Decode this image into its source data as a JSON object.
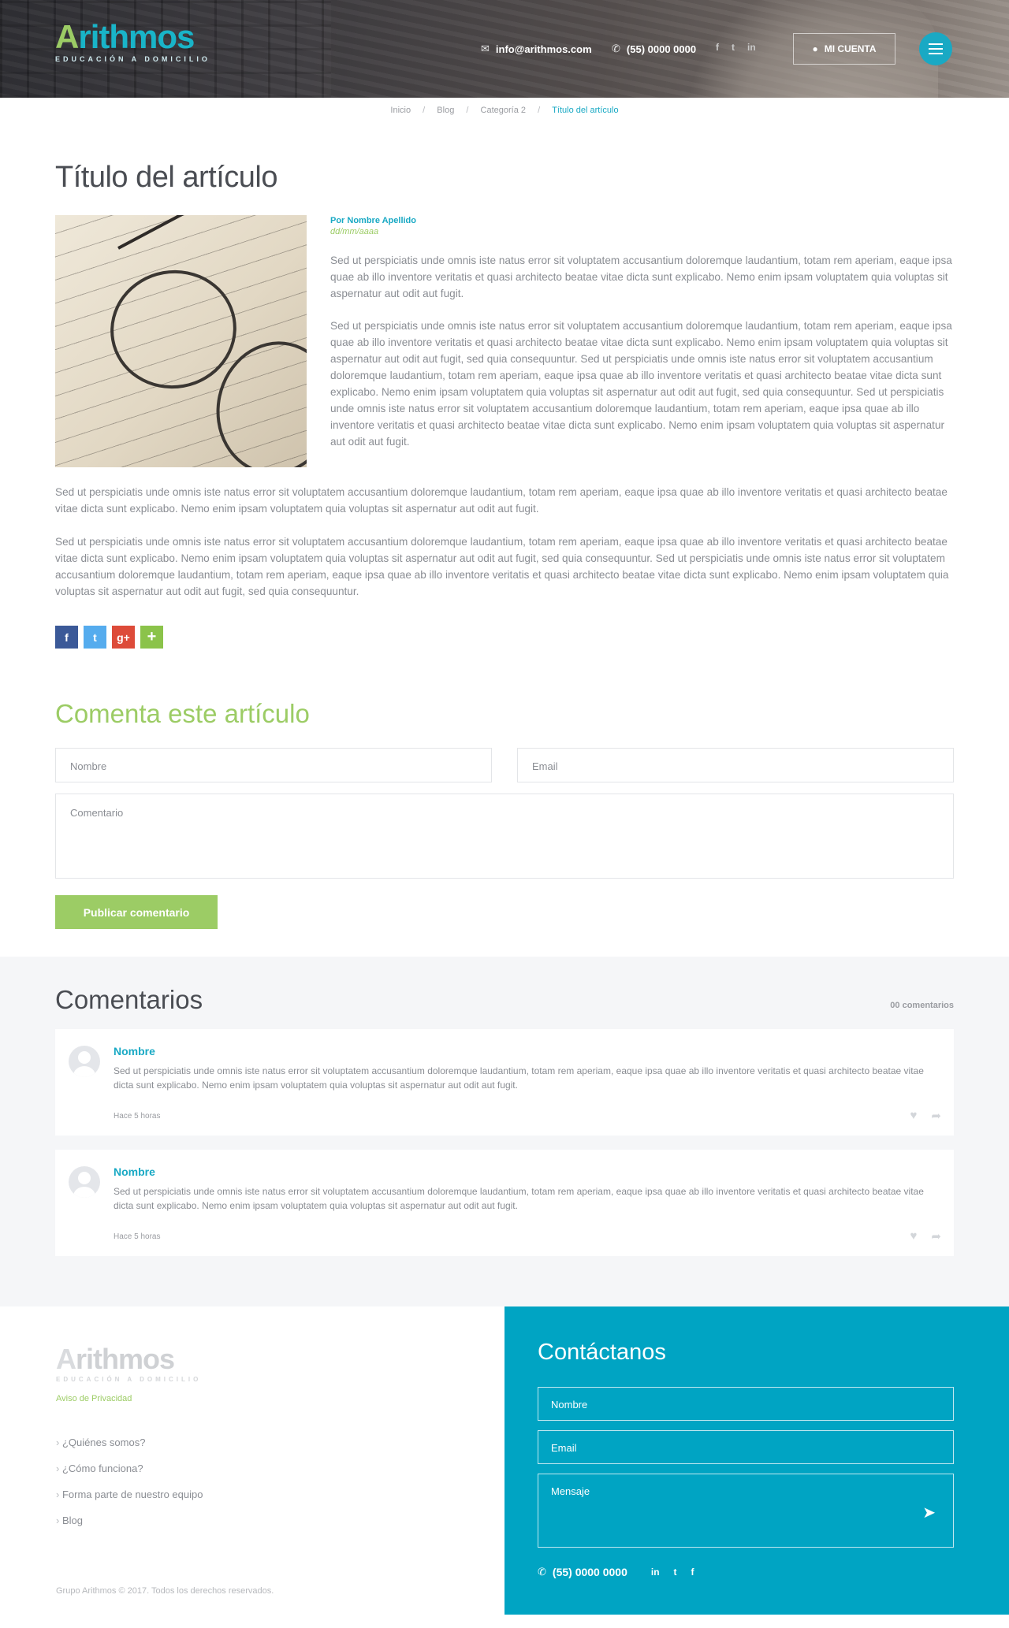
{
  "header": {
    "logo_text": "Arithmos",
    "logo_first_letter": "A",
    "logo_rest": "rithmos",
    "logo_tagline": "EDUCACIÓN A DOMICILIO",
    "email": "info@arithmos.com",
    "phone": "(55) 0000 0000",
    "account_label": "MI CUENTA",
    "social": [
      "facebook-icon",
      "twitter-icon",
      "linkedin-icon"
    ]
  },
  "breadcrumb": {
    "items": [
      "Inicio",
      "Blog",
      "Categoría 2"
    ],
    "current": "Título del artículo",
    "separator": "/"
  },
  "article": {
    "title": "Título del artículo",
    "author": "Por Nombre Apellido",
    "date": "dd/mm/aaaa",
    "paragraphs": [
      "Sed ut perspiciatis unde omnis iste natus error sit voluptatem accusantium doloremque laudantium, totam rem aperiam, eaque ipsa quae ab illo inventore veritatis et quasi architecto beatae vitae dicta sunt explicabo. Nemo enim ipsam voluptatem quia voluptas sit aspernatur aut odit aut fugit.",
      "Sed ut perspiciatis unde omnis iste natus error sit voluptatem accusantium doloremque laudantium, totam rem aperiam, eaque ipsa quae ab illo inventore veritatis et quasi architecto beatae vitae dicta sunt explicabo. Nemo enim ipsam voluptatem quia voluptas sit aspernatur aut odit aut fugit, sed quia consequuntur. Sed ut perspiciatis unde omnis iste natus error sit voluptatem accusantium doloremque laudantium, totam rem aperiam, eaque ipsa quae ab illo inventore veritatis et quasi architecto beatae vitae dicta sunt explicabo. Nemo enim ipsam voluptatem quia voluptas sit aspernatur aut odit aut fugit, sed quia consequuntur. Sed ut perspiciatis unde omnis iste natus error sit voluptatem accusantium doloremque laudantium, totam rem aperiam, eaque ipsa quae ab illo inventore veritatis et quasi architecto beatae vitae dicta sunt explicabo. Nemo enim ipsam voluptatem quia voluptas sit aspernatur aut odit aut fugit.",
      "Sed ut perspiciatis unde omnis iste natus error sit voluptatem accusantium doloremque laudantium, totam rem aperiam, eaque ipsa quae ab illo inventore veritatis et quasi architecto beatae vitae dicta sunt explicabo. Nemo enim ipsam voluptatem quia voluptas sit aspernatur aut odit aut fugit.",
      "Sed ut perspiciatis unde omnis iste natus error sit voluptatem accusantium doloremque laudantium, totam rem aperiam, eaque ipsa quae ab illo inventore veritatis et quasi architecto beatae vitae dicta sunt explicabo. Nemo enim ipsam voluptatem quia voluptas sit aspernatur aut odit aut fugit, sed quia consequuntur. Sed ut perspiciatis unde omnis iste natus error sit voluptatem accusantium doloremque laudantium, totam rem aperiam, eaque ipsa quae ab illo inventore veritatis et quasi architecto beatae vitae dicta sunt explicabo. Nemo enim ipsam voluptatem quia voluptas sit aspernatur aut odit aut fugit, sed quia consequuntur."
    ],
    "share": {
      "facebook": "f",
      "twitter": "t",
      "googleplus": "g+",
      "more": "+"
    }
  },
  "comment_form": {
    "heading": "Comenta este artículo",
    "name_placeholder": "Nombre",
    "email_placeholder": "Email",
    "comment_placeholder": "Comentario",
    "submit_label": "Publicar comentario"
  },
  "comments": {
    "title": "Comentarios",
    "count": "00 comentarios",
    "items": [
      {
        "name": "Nombre",
        "text": "Sed ut perspiciatis unde omnis iste natus error sit voluptatem accusantium doloremque laudantium, totam rem aperiam, eaque ipsa quae ab illo inventore veritatis et quasi architecto beatae vitae dicta sunt explicabo. Nemo enim ipsam voluptatem quia voluptas sit aspernatur aut odit aut fugit.",
        "time": "Hace 5 horas"
      },
      {
        "name": "Nombre",
        "text": "Sed ut perspiciatis unde omnis iste natus error sit voluptatem accusantium doloremque laudantium, totam rem aperiam, eaque ipsa quae ab illo inventore veritatis et quasi architecto beatae vitae dicta sunt explicabo. Nemo enim ipsam voluptatem quia voluptas sit aspernatur aut odit aut fugit.",
        "time": "Hace 5 horas"
      }
    ]
  },
  "footer": {
    "logo_first_letter": "A",
    "logo_rest": "rithmos",
    "logo_tagline": "EDUCACIÓN A DOMICILIO",
    "privacy": "Aviso de Privacidad",
    "links": [
      "¿Quiénes somos?",
      "¿Cómo funciona?",
      "Forma parte de nuestro equipo",
      "Blog"
    ],
    "copyright": "Grupo Arithmos © 2017. Todos los derechos reservados.",
    "contact": {
      "title": "Contáctanos",
      "name_placeholder": "Nombre",
      "email_placeholder": "Email",
      "message_placeholder": "Mensaje",
      "phone": "(55) 0000 0000"
    }
  },
  "colors": {
    "brand_teal": "#19a9c4",
    "brand_green": "#9ccc65",
    "footer_blue": "#00a4c3",
    "comments_bg": "#f5f6f8"
  }
}
